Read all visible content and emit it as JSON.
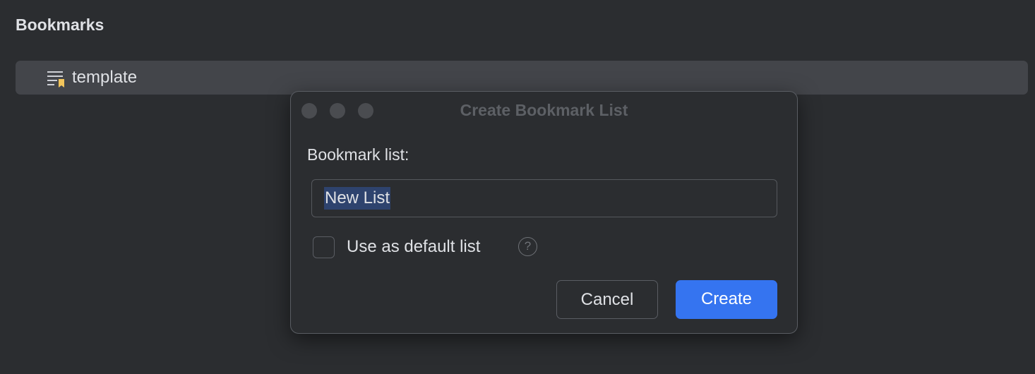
{
  "panel": {
    "title": "Bookmarks",
    "items": [
      {
        "label": "template",
        "icon": "bookmark-list-icon"
      }
    ]
  },
  "dialog": {
    "title": "Create Bookmark List",
    "field_label": "Bookmark list:",
    "field_value": "New List",
    "checkbox_label": "Use as default list",
    "checkbox_checked": false,
    "help": "?",
    "cancel": "Cancel",
    "create": "Create",
    "accent": "#3574f0"
  }
}
